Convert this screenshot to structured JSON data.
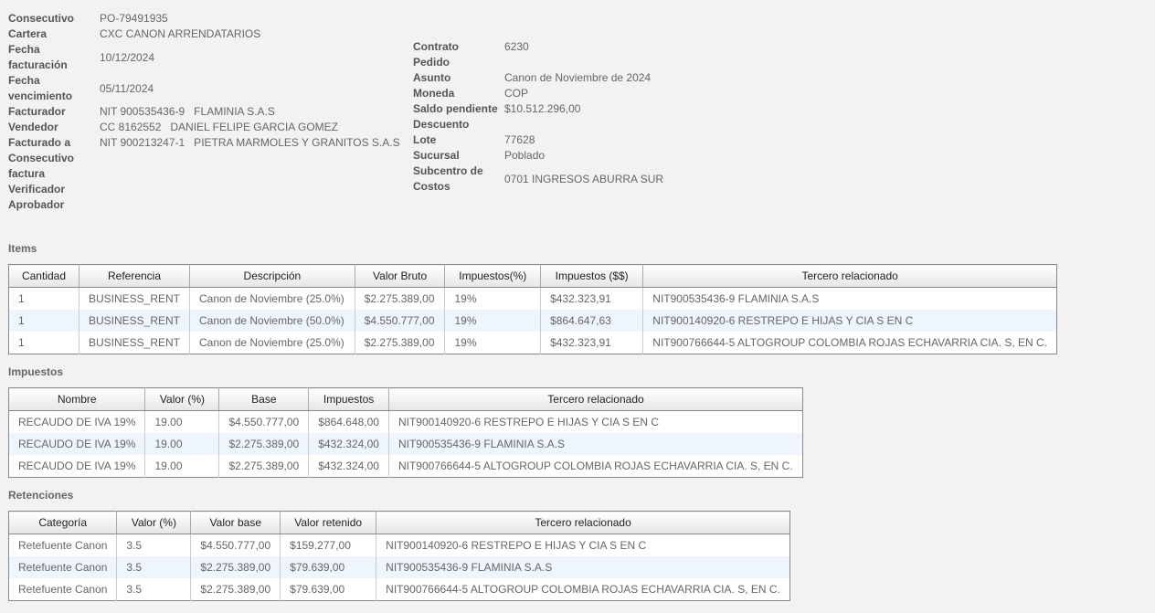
{
  "header_left": [
    {
      "label": "Consecutivo",
      "value": "PO-79491935"
    },
    {
      "label": "Cartera",
      "value": "CXC CANON ARRENDATARIOS"
    },
    {
      "label": "Fecha facturación",
      "value": "10/12/2024"
    },
    {
      "label": "Fecha vencimiento",
      "value": "05/11/2024"
    },
    {
      "label": "Facturador",
      "value": "NIT 900535436-9   FLAMINIA S.A.S"
    },
    {
      "label": "Vendedor",
      "value": "CC 8162552   DANIEL FELIPE GARCIA GOMEZ"
    },
    {
      "label": "Facturado a",
      "value": "NIT 900213247-1   PIETRA MARMOLES Y GRANITOS S.A.S"
    },
    {
      "label": "Consecutivo factura",
      "value": ""
    },
    {
      "label": "Verificador",
      "value": ""
    },
    {
      "label": "Aprobador",
      "value": ""
    }
  ],
  "header_right": [
    {
      "label": "Contrato",
      "value": "6230"
    },
    {
      "label": "Pedido",
      "value": ""
    },
    {
      "label": "Asunto",
      "value": "Canon de Noviembre de 2024"
    },
    {
      "label": "Moneda",
      "value": "COP"
    },
    {
      "label": "Saldo pendiente",
      "value": "$10.512.296,00"
    },
    {
      "label": "Descuento",
      "value": ""
    },
    {
      "label": "Lote",
      "value": "77628"
    },
    {
      "label": "Sucursal",
      "value": "Poblado"
    },
    {
      "label": "Subcentro de Costos",
      "value": "0701 INGRESOS ABURRA SUR"
    }
  ],
  "items": {
    "title": "Items",
    "columns": [
      "Cantidad",
      "Referencia",
      "Descripción",
      "Valor Bruto",
      "Impuestos(%)",
      "Impuestos ($$)",
      "Tercero relacionado"
    ],
    "rows": [
      [
        "1",
        "BUSINESS_RENT",
        "Canon de Noviembre (25.0%)",
        "$2.275.389,00",
        "19%",
        "$432.323,91",
        "NIT900535436-9 FLAMINIA S.A.S"
      ],
      [
        "1",
        "BUSINESS_RENT",
        "Canon de Noviembre (50.0%)",
        "$4.550.777,00",
        "19%",
        "$864.647,63",
        "NIT900140920-6 RESTREPO E HIJAS Y CIA S EN C"
      ],
      [
        "1",
        "BUSINESS_RENT",
        "Canon de Noviembre (25.0%)",
        "$2.275.389,00",
        "19%",
        "$432.323,91",
        "NIT900766644-5 ALTOGROUP COLOMBIA ROJAS ECHAVARRIA CIA. S, EN C."
      ]
    ]
  },
  "impuestos": {
    "title": "Impuestos",
    "columns": [
      "Nombre",
      "Valor (%)",
      "Base",
      "Impuestos",
      "Tercero relacionado"
    ],
    "rows": [
      [
        "RECAUDO DE IVA 19%",
        "19.00",
        "$4.550.777,00",
        "$864.648,00",
        "NIT900140920-6 RESTREPO E HIJAS Y CIA S EN C"
      ],
      [
        "RECAUDO DE IVA 19%",
        "19.00",
        "$2.275.389,00",
        "$432.324,00",
        "NIT900535436-9 FLAMINIA S.A.S"
      ],
      [
        "RECAUDO DE IVA 19%",
        "19.00",
        "$2.275.389,00",
        "$432.324,00",
        "NIT900766644-5 ALTOGROUP COLOMBIA ROJAS ECHAVARRIA CIA. S, EN C."
      ]
    ]
  },
  "retenciones": {
    "title": "Retenciones",
    "columns": [
      "Categoría",
      "Valor (%)",
      "Valor base",
      "Valor retenido",
      "Tercero relacionado"
    ],
    "rows": [
      [
        "Retefuente Canon",
        "3.5",
        "$4.550.777,00",
        "$159.277,00",
        "NIT900140920-6 RESTREPO E HIJAS Y CIA S EN C"
      ],
      [
        "Retefuente Canon",
        "3.5",
        "$2.275.389,00",
        "$79.639,00",
        "NIT900535436-9 FLAMINIA S.A.S"
      ],
      [
        "Retefuente Canon",
        "3.5",
        "$2.275.389,00",
        "$79.639,00",
        "NIT900766644-5 ALTOGROUP COLOMBIA ROJAS ECHAVARRIA CIA. S, EN C."
      ]
    ]
  }
}
